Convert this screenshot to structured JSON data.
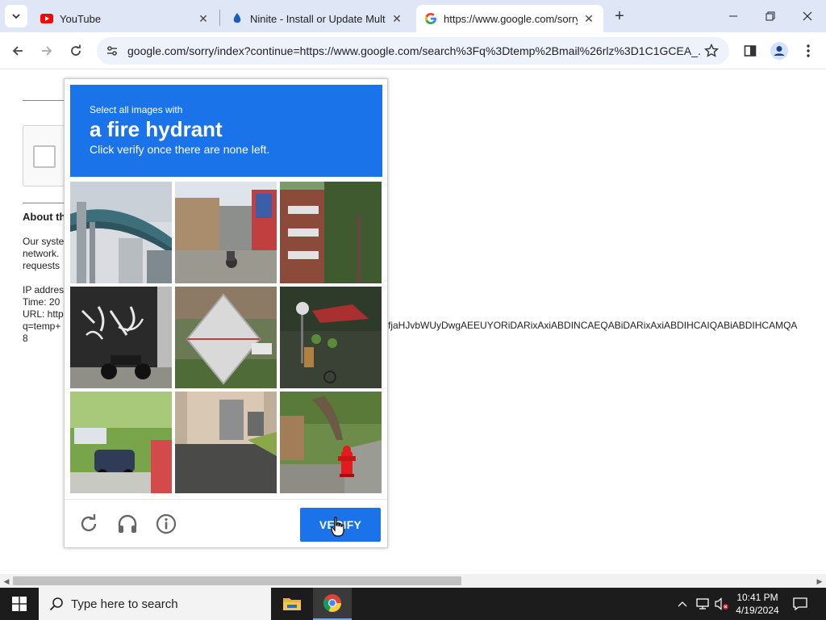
{
  "browser": {
    "tabs": [
      {
        "title": "YouTube",
        "icon": "youtube-icon"
      },
      {
        "title": "Ninite - Install or Update Multiple Apps at Once",
        "icon": "ninite-icon"
      },
      {
        "title": "https://www.google.com/sorry/index",
        "icon": "google-icon",
        "active": true
      }
    ],
    "url": "google.com/sorry/index?continue=https://www.google.com/search%3Fq%3Dtemp%2Bmail%26rlz%3D1C1GCEA_..."
  },
  "page": {
    "about_title": "About th",
    "para1": [
      "Our syste",
      "network.",
      "requests"
    ],
    "para2": [
      "IP addres",
      "Time: 20",
      "URL: http",
      "q=temp+",
      "8"
    ],
    "long_line": "fjaHJvbWUyDwgAEEUYORiDARixAxiABDINCAEQABiDARixAxiABDIHCAIQABiABDIHCAMQA"
  },
  "captcha": {
    "instruction_small": "Select all images with",
    "instruction_big": "a fire hydrant",
    "instruction_sub": "Click verify once there are none left.",
    "verify_label": "VERIFY",
    "tiles": [
      "overpass-bridge",
      "street-with-motorbike",
      "apartment-building",
      "motorcycle-graffiti-wall",
      "diamond-road-sign",
      "street-market",
      "parked-car-trees",
      "building-entrance",
      "tree-with-fire-hydrant"
    ]
  },
  "taskbar": {
    "search_placeholder": "Type here to search",
    "time": "10:41 PM",
    "date": "4/19/2024"
  },
  "colors": {
    "accent": "#1a73e8",
    "tabstrip": "#dfe7f6",
    "taskbar": "#1c1c1c"
  }
}
